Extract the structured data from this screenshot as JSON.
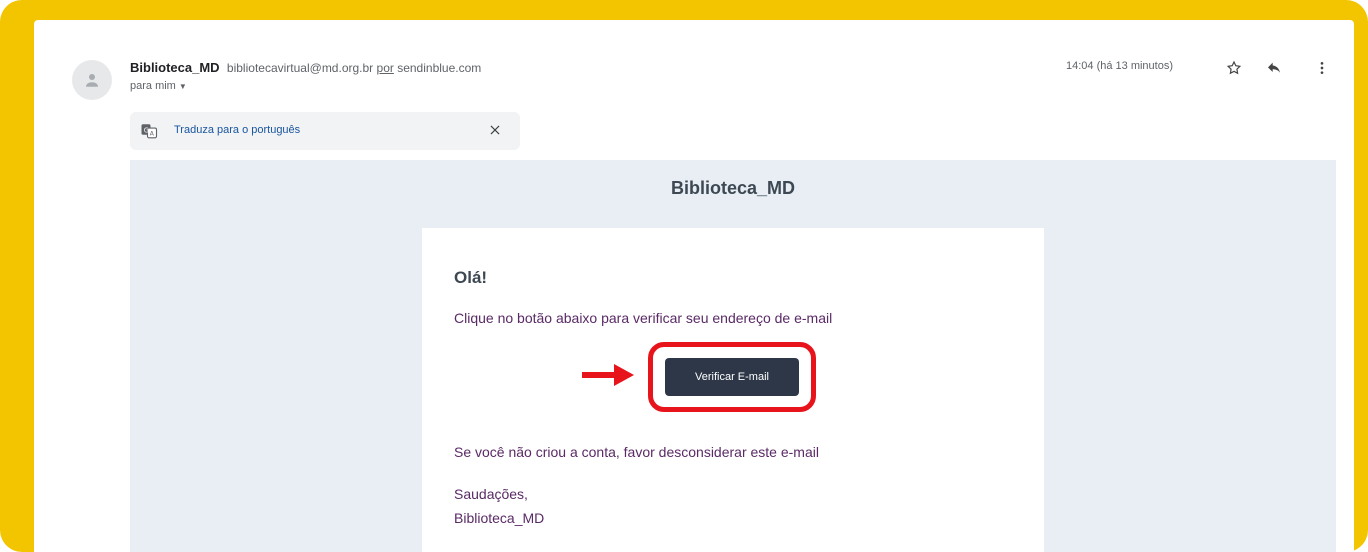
{
  "header": {
    "sender_name": "Biblioteca_MD",
    "sender_email": "bibliotecavirtual@md.org.br",
    "via_label": "por",
    "via_domain": "sendinblue.com",
    "to_label": "para mim",
    "time": "14:04 (há 13 minutos)",
    "icons": [
      "avatar-person-icon",
      "star-icon",
      "reply-icon",
      "more-vert-icon"
    ]
  },
  "translate_bar": {
    "label": "Traduza para o português",
    "icons": [
      "translate-icon",
      "close-icon"
    ]
  },
  "email": {
    "brand": "Biblioteca_MD",
    "greeting": "Olá!",
    "intro": "Clique no botão abaixo para verificar seu endereço de e-mail",
    "button_label": "Verificar E-mail",
    "disclaimer": "Se você não criou a conta, favor desconsiderar este e-mail",
    "closing": "Saudações,",
    "signature": "Biblioteca_MD"
  },
  "colors": {
    "frame": "#f2c500",
    "email_bg": "#e8eef4",
    "button": "#2d3748",
    "highlight": "#e8141c",
    "body_text": "#5a2a66"
  }
}
